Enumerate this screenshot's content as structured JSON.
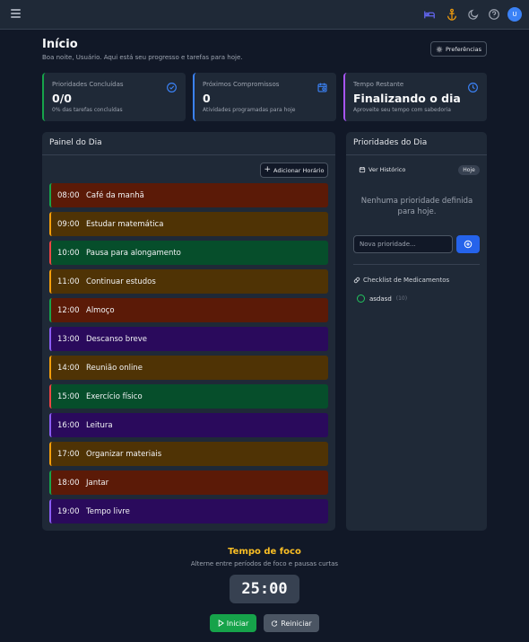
{
  "header": {
    "icons": [
      "menu-icon",
      "bed-icon",
      "anchor-icon",
      "moon-icon",
      "help-icon"
    ],
    "avatar_initial": "U"
  },
  "page": {
    "title": "Início",
    "subtitle": "Boa noite, Usuário. Aqui está seu progresso e tarefas para hoje.",
    "preferences_label": "Preferências"
  },
  "stats": [
    {
      "label": "Prioridades Concluídas",
      "value": "0/0",
      "sub": "0% das tarefas concluídas",
      "accent": "#16a34a",
      "icon": "check-circle-icon"
    },
    {
      "label": "Próximos Compromissos",
      "value": "0",
      "sub": "Atividades programadas para hoje",
      "accent": "#3b82f6",
      "icon": "calendar-icon"
    },
    {
      "label": "Tempo Restante",
      "value": "Finalizando o dia",
      "sub": "Aproveite seu tempo com sabedoria",
      "accent": "#a855f7",
      "icon": "clock-icon"
    }
  ],
  "day_panel": {
    "title": "Painel do Dia",
    "add_label": "Adicionar Horário",
    "slots": [
      {
        "time": "08:00",
        "label": "Café da manhã",
        "color": "red"
      },
      {
        "time": "09:00",
        "label": "Estudar matemática",
        "color": "amber"
      },
      {
        "time": "10:00",
        "label": "Pausa para alongamento",
        "color": "green"
      },
      {
        "time": "11:00",
        "label": "Continuar estudos",
        "color": "amber"
      },
      {
        "time": "12:00",
        "label": "Almoço",
        "color": "red"
      },
      {
        "time": "13:00",
        "label": "Descanso breve",
        "color": "purple"
      },
      {
        "time": "14:00",
        "label": "Reunião online",
        "color": "amber"
      },
      {
        "time": "15:00",
        "label": "Exercício físico",
        "color": "green"
      },
      {
        "time": "16:00",
        "label": "Leitura",
        "color": "purple"
      },
      {
        "time": "17:00",
        "label": "Organizar materiais",
        "color": "amber"
      },
      {
        "time": "18:00",
        "label": "Jantar",
        "color": "red"
      },
      {
        "time": "19:00",
        "label": "Tempo livre",
        "color": "purple"
      }
    ]
  },
  "priorities": {
    "title": "Prioridades do Dia",
    "history_label": "Ver Histórico",
    "today_badge": "Hoje",
    "empty_text": "Nenhuma prioridade definida para hoje.",
    "input_placeholder": "Nova prioridade...",
    "med_title": "Checklist de Medicamentos",
    "med_items": [
      {
        "name": "asdasd",
        "count": "(10)"
      }
    ]
  },
  "focus": {
    "title": "Tempo de foco",
    "subtitle": "Alterne entre períodos de foco e pausas curtas",
    "timer": "25:00",
    "start_label": "Iniciar",
    "reset_label": "Reiniciar"
  }
}
